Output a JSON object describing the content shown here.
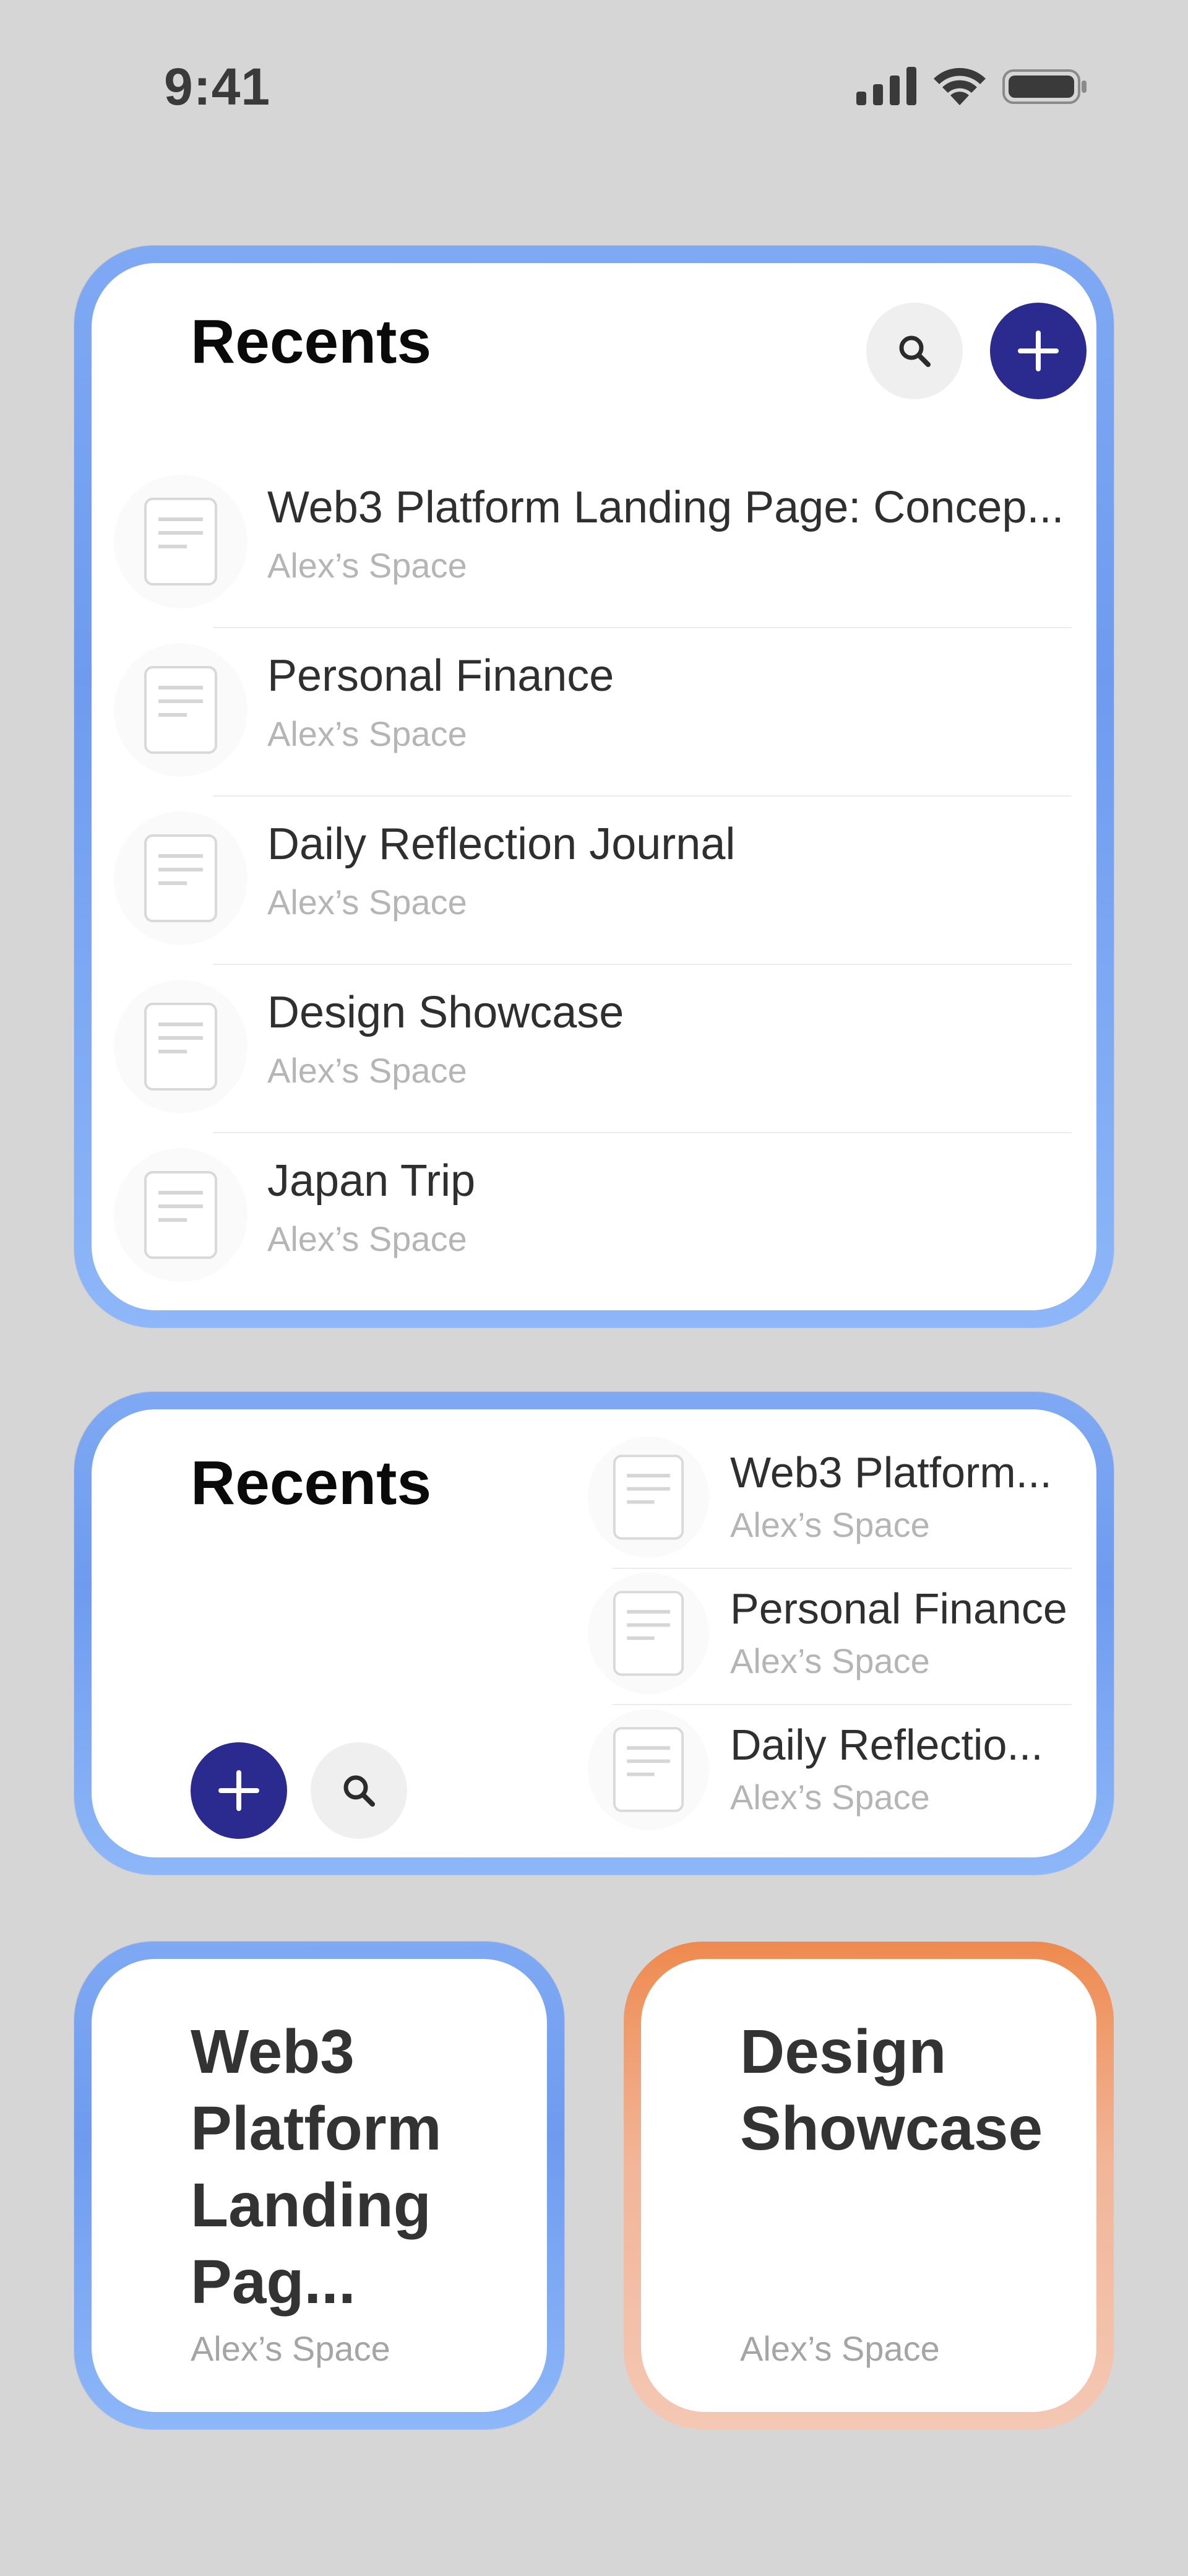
{
  "status_bar": {
    "time": "9:41",
    "icons": [
      "signal-icon",
      "wifi-icon",
      "battery-icon"
    ]
  },
  "colors": {
    "background": "#d6d6d6",
    "blue_frame": "#7fa9f3",
    "orange_frame": "#ee8a4f",
    "add_button": "#2a2a8f"
  },
  "widget_large": {
    "title": "Recents",
    "search_icon": "search-icon",
    "add_icon": "plus-icon",
    "items": [
      {
        "title": "Web3 Platform Landing Page: Concep...",
        "subtitle": "Alex’s Space"
      },
      {
        "title": "Personal Finance",
        "subtitle": "Alex’s Space"
      },
      {
        "title": "Daily Reflection Journal",
        "subtitle": "Alex’s Space"
      },
      {
        "title": "Design Showcase",
        "subtitle": "Alex’s Space"
      },
      {
        "title": "Japan Trip",
        "subtitle": "Alex’s Space"
      }
    ]
  },
  "widget_medium": {
    "title": "Recents",
    "items": [
      {
        "title": "Web3 Platform...",
        "subtitle": "Alex’s Space"
      },
      {
        "title": "Personal Finance",
        "subtitle": "Alex’s Space"
      },
      {
        "title": "Daily Reflectio...",
        "subtitle": "Alex’s Space"
      }
    ]
  },
  "widget_small_1": {
    "title": "Web3 Platform Landing Pag...",
    "subtitle": "Alex’s Space"
  },
  "widget_small_2": {
    "title": "Design Showcase",
    "subtitle": "Alex’s Space"
  }
}
